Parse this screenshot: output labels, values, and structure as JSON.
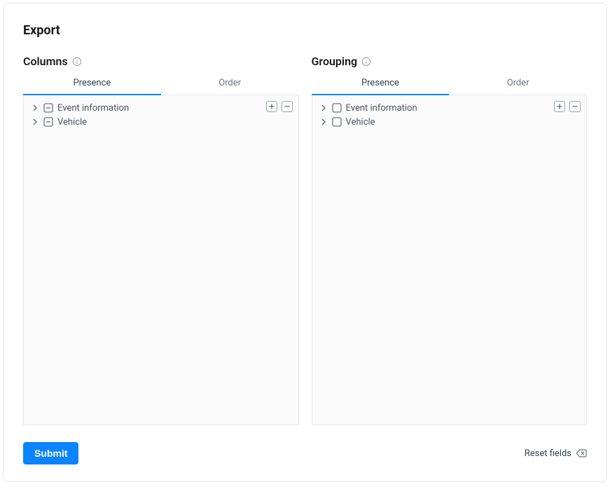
{
  "page_title": "Export",
  "columns": {
    "title": "Columns",
    "tabs": {
      "presence": "Presence",
      "order": "Order"
    },
    "items": [
      {
        "label": "Event information",
        "state": "indeterminate"
      },
      {
        "label": "Vehicle",
        "state": "indeterminate"
      }
    ]
  },
  "grouping": {
    "title": "Grouping",
    "tabs": {
      "presence": "Presence",
      "order": "Order"
    },
    "items": [
      {
        "label": "Event information",
        "state": "unchecked"
      },
      {
        "label": "Vehicle",
        "state": "unchecked"
      }
    ]
  },
  "footer": {
    "submit": "Submit",
    "reset": "Reset fields"
  }
}
